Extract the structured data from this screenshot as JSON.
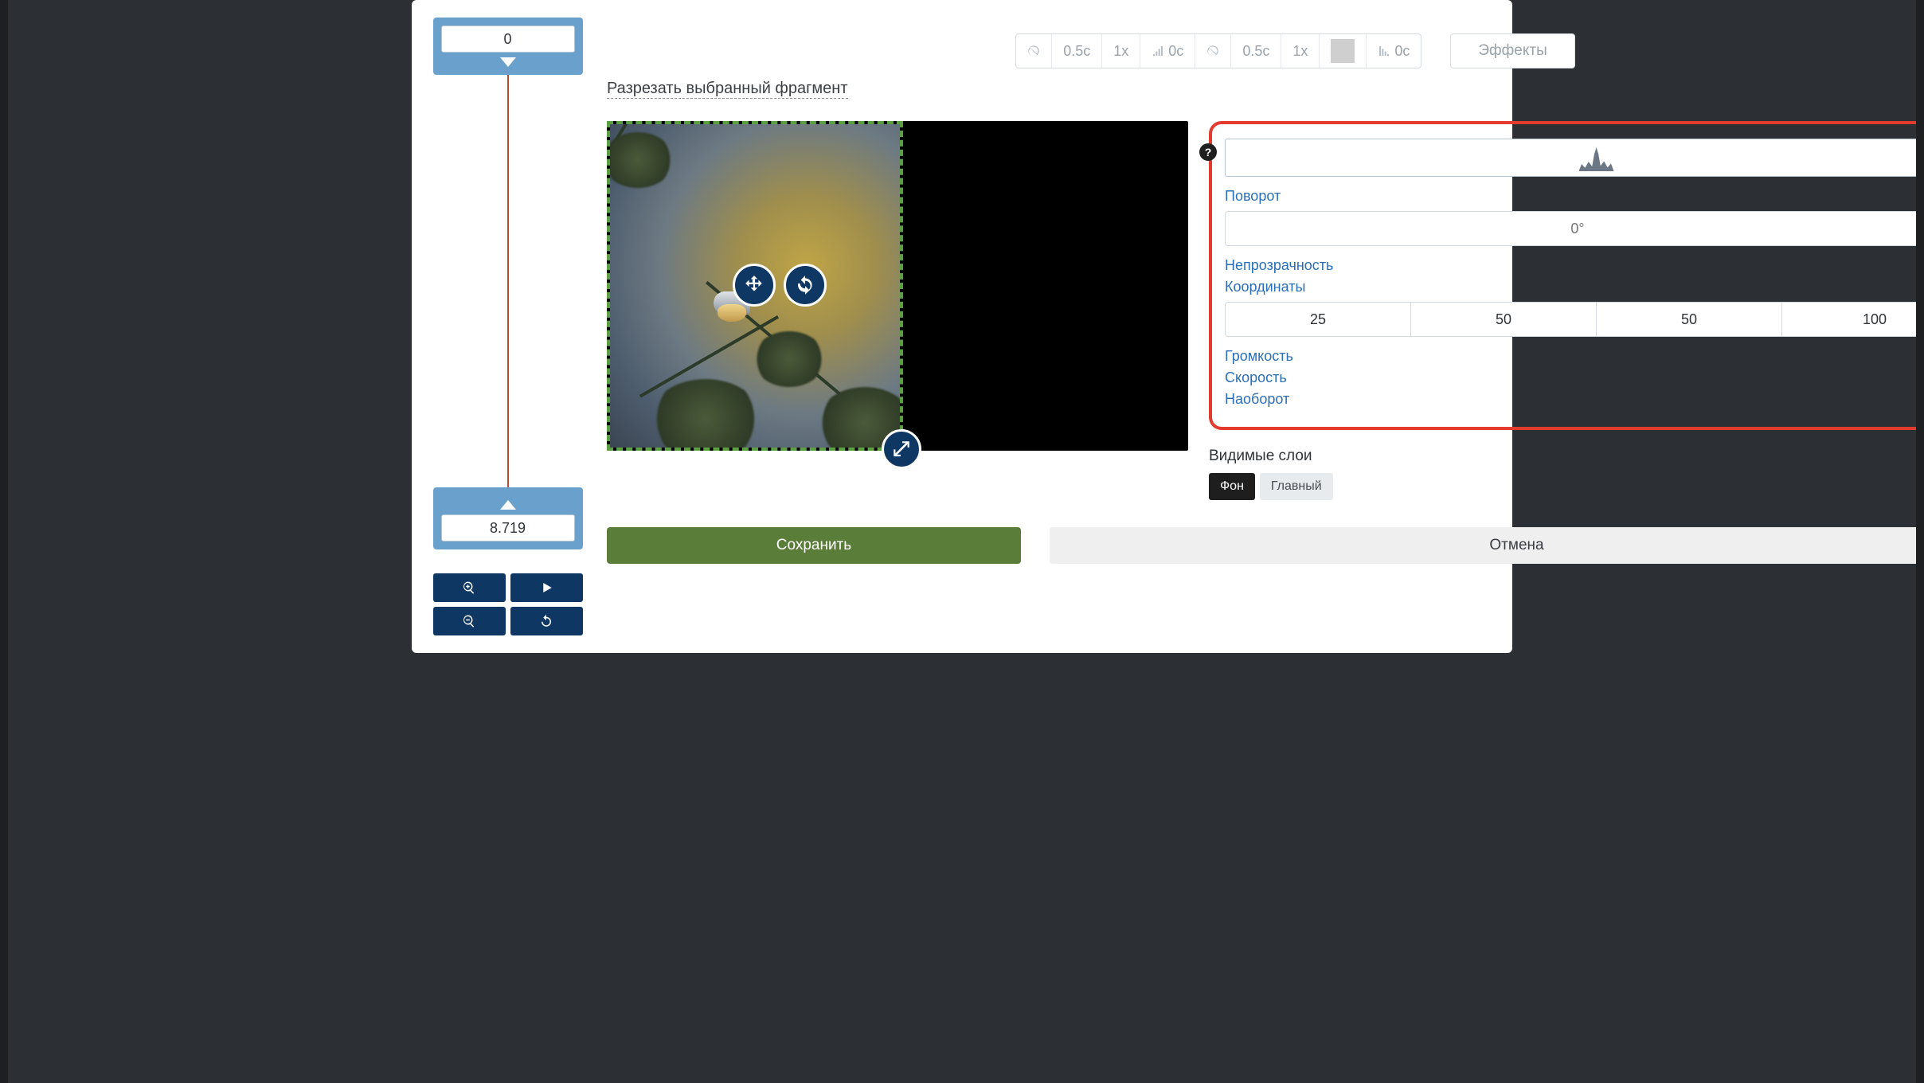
{
  "timeline": {
    "start_value": "0",
    "end_value": "8.719"
  },
  "toolbar": {
    "groupA": {
      "dur": "0.5с",
      "speed": "1x",
      "fade": "0с"
    },
    "groupB": {
      "dur": "0.5с",
      "speed": "1x",
      "fade": "0с"
    },
    "effects_label": "Эффекты"
  },
  "cut_link": "Разрезать выбранный фрагмент",
  "panel": {
    "rotation_label": "Поворот",
    "rotation_value": "0°",
    "opacity_label": "Непрозрачность",
    "coords_label": "Координаты",
    "coords": {
      "x1": "25",
      "y1": "50",
      "x2": "50",
      "y2": "100"
    },
    "volume_label": "Громкость",
    "speed_label": "Скорость",
    "reverse_label": "Наоборот"
  },
  "layers": {
    "title": "Видимые слои",
    "bg": "Фон",
    "main": "Главный"
  },
  "footer": {
    "save": "Сохранить",
    "cancel": "Отмена"
  },
  "help_badge": "?"
}
